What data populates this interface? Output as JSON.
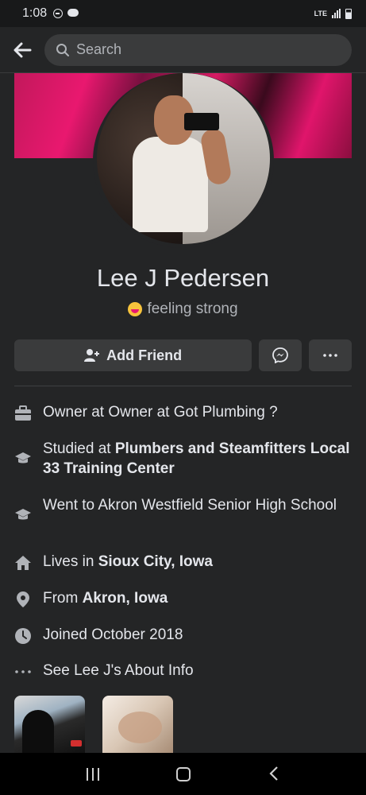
{
  "status": {
    "time": "1:08",
    "network": "LTE"
  },
  "header": {
    "search_placeholder": "Search",
    "icons": [
      "back-arrow-icon",
      "search-icon"
    ]
  },
  "profile": {
    "name": "Lee J Pedersen",
    "feeling": "feeling strong",
    "feeling_icon": "strong-emoji-icon"
  },
  "actions": {
    "add_friend_label": "Add Friend",
    "messenger_icon": "messenger-icon",
    "more_icon": "more-icon"
  },
  "info": [
    {
      "icon": "briefcase-icon",
      "prefix": "Owner at Owner at Got Plumbing ?",
      "bold": "",
      "suffix": ""
    },
    {
      "icon": "graduation-cap-icon",
      "prefix": "Studied at ",
      "bold": "Plumbers and Steamfitters Local 33 Training Center",
      "suffix": ""
    },
    {
      "icon": "graduation-cap-icon",
      "prefix": "Went to Akron Westfield Senior High School",
      "bold": "",
      "suffix": ""
    },
    {
      "icon": "home-icon",
      "prefix": "Lives in ",
      "bold": "Sioux City, Iowa",
      "suffix": ""
    },
    {
      "icon": "location-pin-icon",
      "prefix": "From ",
      "bold": "Akron, Iowa",
      "suffix": ""
    },
    {
      "icon": "clock-icon",
      "prefix": "Joined October 2018",
      "bold": "",
      "suffix": ""
    },
    {
      "icon": "ellipsis-icon",
      "prefix": "See Lee J's About Info",
      "bold": "",
      "suffix": ""
    }
  ],
  "colors": {
    "background": "#242526",
    "surface": "#3a3b3c",
    "text_primary": "#e4e6eb",
    "text_secondary": "#b0b3b8"
  }
}
